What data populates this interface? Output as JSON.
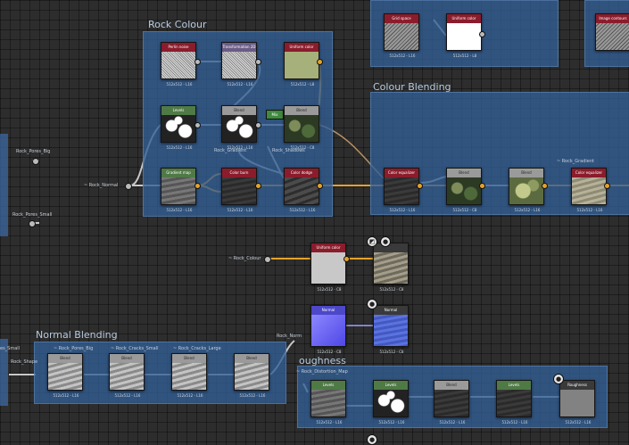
{
  "frames": {
    "rock_colour": "Rock Colour",
    "colour_blending": "Colour Blending",
    "normal_blending": "Normal Blending",
    "roughness": "oughness"
  },
  "top_nodes": [
    {
      "header": "Grid space",
      "caption": "512x512 - L16"
    },
    {
      "header": "Uniform color",
      "caption": "512x512 - L8"
    },
    {
      "header": "Image contours",
      "caption": ""
    }
  ],
  "rock_colour_nodes": [
    {
      "header": "Perlin noise",
      "caption": "512x512 - L16"
    },
    {
      "header": "Transformation 2D",
      "caption": "512x512 - L16"
    },
    {
      "header": "Uniform color",
      "caption": "512x512 - L8"
    },
    {
      "header": "Levels",
      "caption": "512x512 - L16"
    },
    {
      "header": "Blend",
      "caption": "512x512 - L16"
    },
    {
      "header": "Blend",
      "caption": "512x512 - C8"
    },
    {
      "header": "Gradient map",
      "caption": "512x512 - L16"
    },
    {
      "header": "Color burn",
      "caption": "512x512 - L16"
    },
    {
      "header": "Color dodge",
      "caption": "512x512 - L16"
    }
  ],
  "colour_blending_nodes": [
    {
      "header": "Color equalizer",
      "caption": "512x512 - L16"
    },
    {
      "header": "Blend",
      "caption": "512x512 - C8"
    },
    {
      "header": "Blend",
      "caption": "512x512 - L16"
    },
    {
      "header": "Color equalizer",
      "caption": "512x512 - L16"
    }
  ],
  "middle_nodes": [
    {
      "header": "Uniform color",
      "caption": "512x512 - C8"
    },
    {
      "header": "",
      "caption": "512x512 - C8"
    },
    {
      "header": "Normal",
      "caption": "512x512 - C8"
    },
    {
      "header": "Normal",
      "caption": "512x512 - C8"
    }
  ],
  "normal_nodes": [
    {
      "header": "Blend",
      "caption": "512x512 - L16"
    },
    {
      "header": "Blend",
      "caption": "512x512 - L16"
    },
    {
      "header": "Blend",
      "caption": "512x512 - L16"
    },
    {
      "header": "Blend",
      "caption": "512x512 - L16"
    }
  ],
  "roughness_nodes": [
    {
      "header": "Levels",
      "caption": "512x512 - L16"
    },
    {
      "header": "Levels",
      "caption": "512x512 - L16"
    },
    {
      "header": "Blend",
      "caption": "512x512 - L16"
    },
    {
      "header": "Levels",
      "caption": "512x512 - L16"
    },
    {
      "header": "Roughness",
      "caption": "512x512 - L16"
    }
  ],
  "labels": {
    "rock_pores_big": "Rock_Pores_Big",
    "rock_pores_small": "Rock_Pores_Small",
    "rock_normal": "~ Rock_Normal",
    "rock_gradient": "Rock_Gradient",
    "rock_shadows": "Rock_Shadows",
    "rock_gradient2": "~ Rock_Gradient",
    "rock_colour": "~ Rock_Colour",
    "pores_small_left": "es_Small",
    "rock_shape": "Rock_Shape",
    "nb_pores_big": "~ Rock_Pores_Big",
    "nb_cracks_small": "~ Rock_Cracks_Small",
    "nb_cracks_large": "~ Rock_Cracks_Large",
    "rock_norm": "Rock_Norm",
    "rock_distortion": "~ Rock_Distortion_Map",
    "mix_label": "Mix"
  },
  "colors": {
    "frame": "#325f96",
    "wire_color": "#e6a22c",
    "wire_gray": "#c8c8c8"
  }
}
